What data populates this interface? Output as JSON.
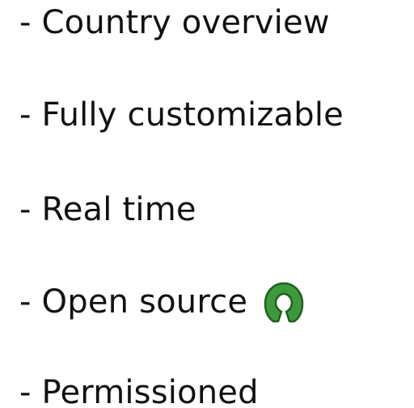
{
  "features": [
    {
      "label": "- Country overview"
    },
    {
      "label": "- Fully customizable"
    },
    {
      "label": "- Real time"
    },
    {
      "label": "- Open source",
      "icon": "open-source-initiative-icon",
      "icon_color": "#3c9a3c"
    },
    {
      "label": "- Permissioned"
    }
  ],
  "colors": {
    "text": "#111111",
    "logo_green": "#3c9a3c",
    "logo_outline": "#1f5f1f"
  }
}
